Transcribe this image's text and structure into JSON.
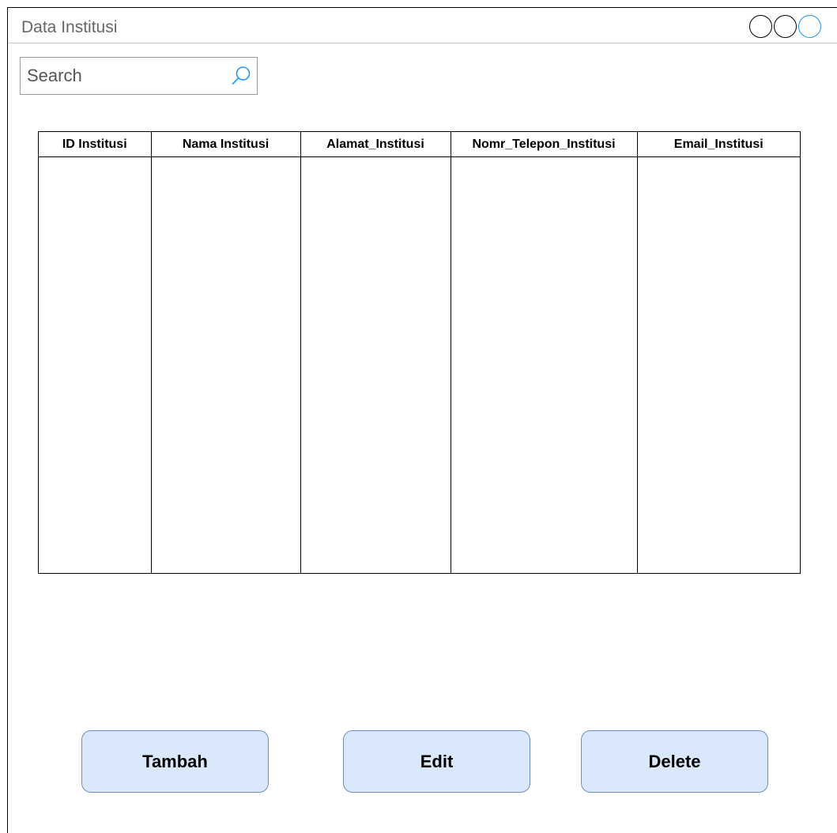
{
  "window": {
    "title": "Data Institusi"
  },
  "search": {
    "placeholder": "Search"
  },
  "table": {
    "columns": [
      "ID Institusi",
      "Nama Institusi",
      "Alamat_Institusi",
      "Nomr_Telepon_Institusi",
      "Email_Institusi"
    ],
    "rows": []
  },
  "actions": {
    "add_label": "Tambah",
    "edit_label": "Edit",
    "delete_label": "Delete"
  },
  "colors": {
    "button_fill": "#dae8fc",
    "button_border": "#6c8ebf",
    "search_icon": "#2196f3",
    "active_control": "#2196f3"
  },
  "icons": {
    "search": "search-icon"
  }
}
